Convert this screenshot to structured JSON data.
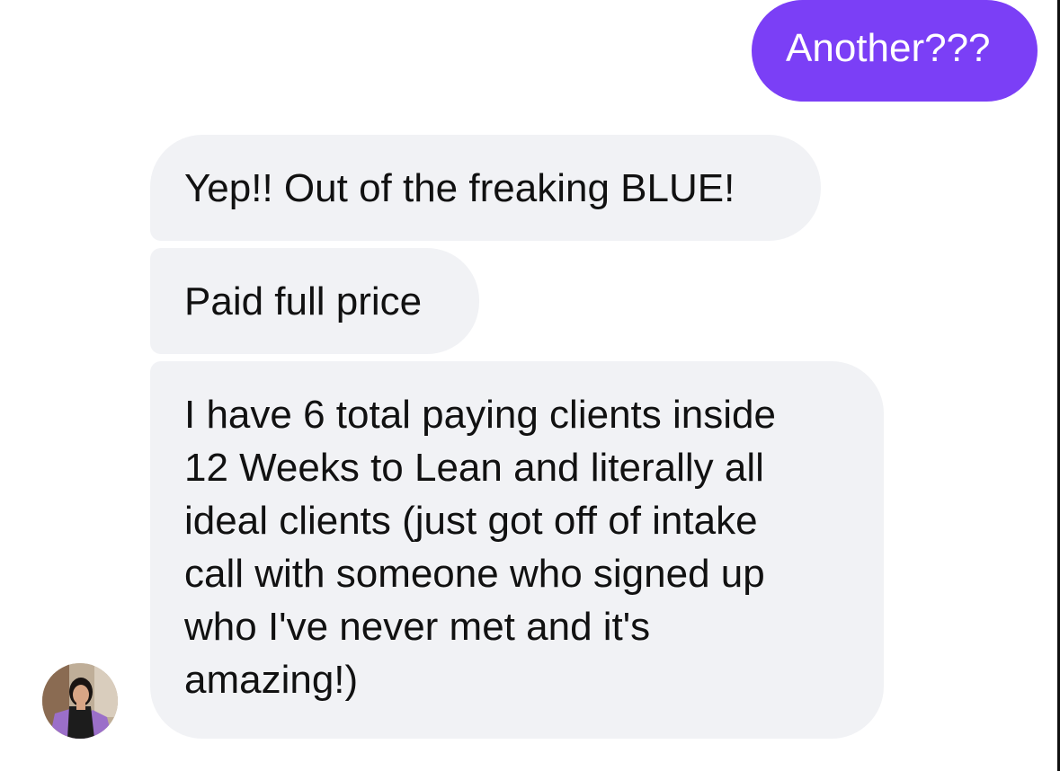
{
  "conversation": {
    "sent_message": "Another???",
    "received_messages": [
      "Yep!! Out of the freaking BLUE!",
      "Paid full price"
    ],
    "long_message_lines": [
      "I have 6 total paying clients inside",
      "12 Weeks to Lean and literally all",
      "ideal clients (just got off of intake",
      "call with someone who signed up",
      "who I've never met and it's",
      "amazing!)"
    ]
  },
  "theme": {
    "sent_bubble_color": "#7B3FF6",
    "received_bubble_color": "#F1F2F5",
    "text_color": "#111111",
    "avatar_icon": "person-avatar-icon"
  }
}
